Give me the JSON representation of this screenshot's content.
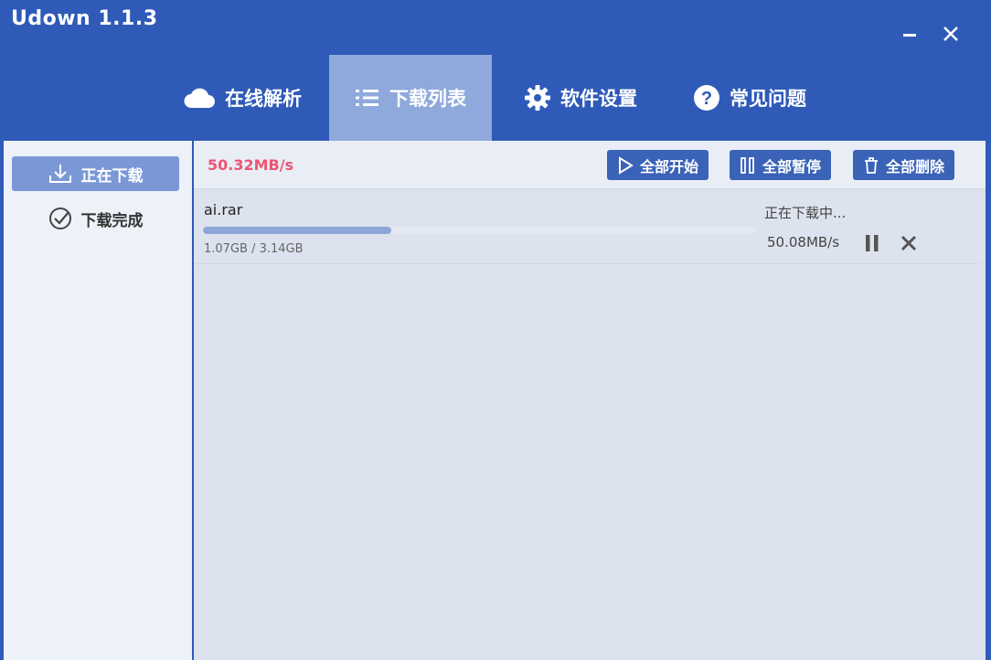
{
  "window": {
    "title": "Udown 1.1.3"
  },
  "tabs": [
    {
      "label": "在线解析",
      "icon": "cloud-icon"
    },
    {
      "label": "下载列表",
      "icon": "list-icon"
    },
    {
      "label": "软件设置",
      "icon": "gear-icon"
    },
    {
      "label": "常见问题",
      "icon": "question-icon"
    }
  ],
  "active_tab": 1,
  "sidebar": {
    "items": [
      {
        "label": "正在下载",
        "icon": "download-icon",
        "active": true
      },
      {
        "label": "下载完成",
        "icon": "check-circle-icon",
        "active": false
      }
    ]
  },
  "toolbar": {
    "total_speed": "50.32MB/s",
    "start_all_label": "全部开始",
    "pause_all_label": "全部暂停",
    "delete_all_label": "全部删除"
  },
  "downloads": [
    {
      "file_name": "ai.rar",
      "size_text": "1.07GB / 3.14GB",
      "progress": 0.34,
      "status": "正在下载中...",
      "speed": "50.08MB/s"
    }
  ],
  "colors": {
    "titlebar": "#2f5ab8",
    "active_tab": "#8fa9dc",
    "button": "#3a63b8",
    "speed_accent": "#ef5473",
    "progress_fill": "#8ea5d7"
  }
}
